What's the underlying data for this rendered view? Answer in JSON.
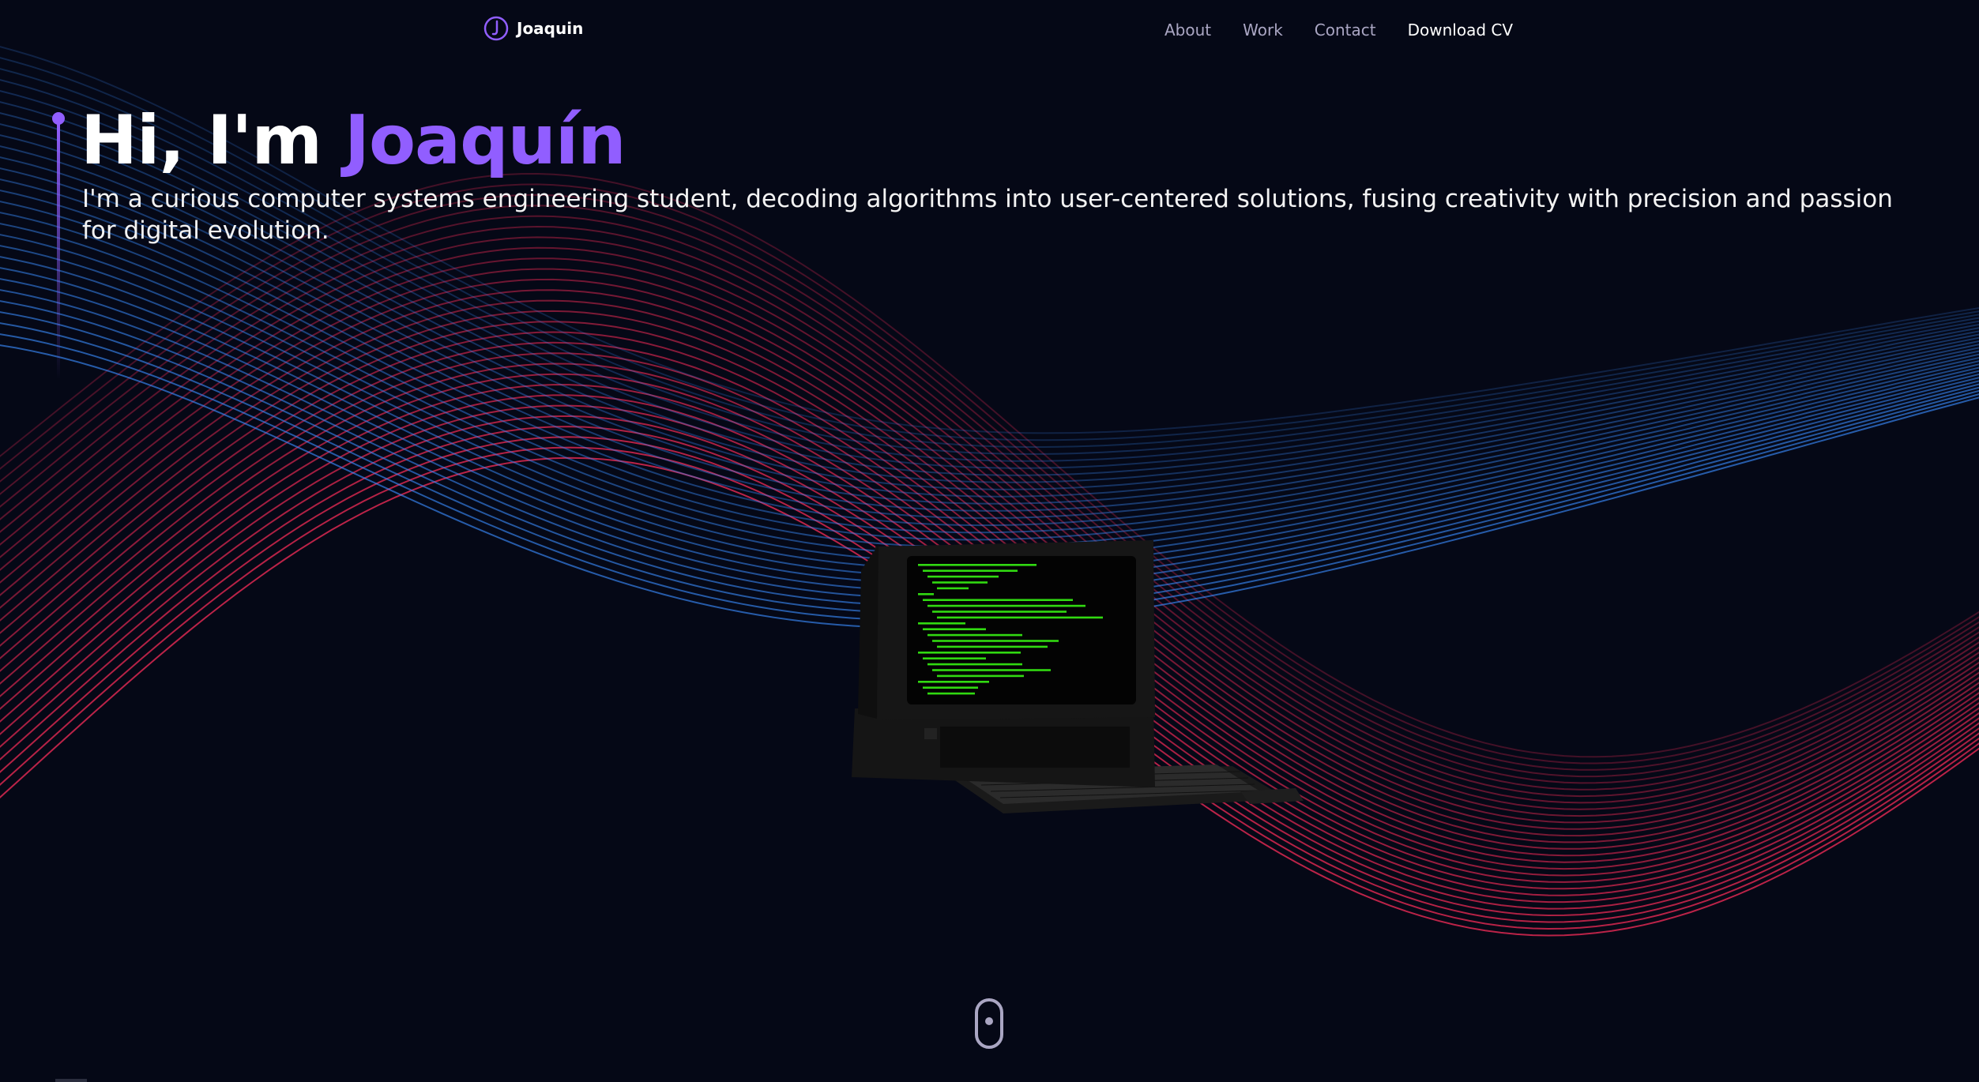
{
  "nav": {
    "logo_text": "Joaquin",
    "links": [
      {
        "label": "About"
      },
      {
        "label": "Work"
      },
      {
        "label": "Contact"
      },
      {
        "label": "Download CV"
      }
    ]
  },
  "hero": {
    "greeting": "Hi, I'm ",
    "name": "Joaquín",
    "subtitle": "I'm a curious computer systems engineering student, decoding algorithms into user-centered solutions, fusing creativity with precision and passion for digital evolution."
  },
  "icons": {
    "logo": "circle-logo-icon",
    "scroll": "mouse-scroll-icon"
  },
  "colors": {
    "background": "#050816",
    "accent": "#915eff",
    "wave_red": "#ff2d5a",
    "wave_blue": "#3a8dff",
    "terminal_green": "#39ff14"
  }
}
